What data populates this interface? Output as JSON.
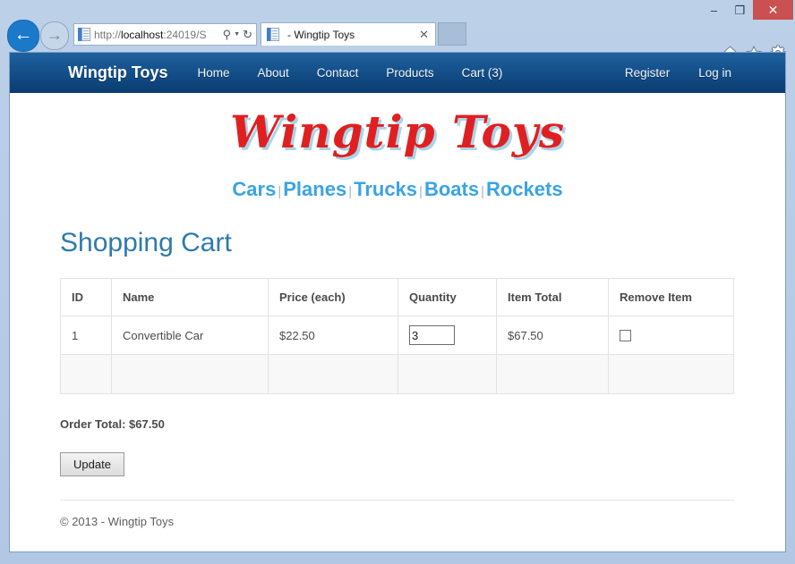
{
  "window": {
    "minimize_label": "–",
    "maximize_label": "❒",
    "close_label": "✕"
  },
  "browser": {
    "back_label": "←",
    "forward_label": "→",
    "url_prefix": "http://",
    "url_host": "localhost",
    "url_suffix": ":24019/S",
    "search_icon": "⚲",
    "caret_icon": "▼",
    "refresh_icon": "↻",
    "tab_title": "- Wingtip Toys",
    "tab_close_label": "✕",
    "new_tab_label": ""
  },
  "navbar": {
    "brand": "Wingtip Toys",
    "links": [
      {
        "label": "Home"
      },
      {
        "label": "About"
      },
      {
        "label": "Contact"
      },
      {
        "label": "Products"
      },
      {
        "label": "Cart (3)"
      }
    ],
    "right_links": [
      {
        "label": "Register"
      },
      {
        "label": "Log in"
      }
    ]
  },
  "logo": {
    "text": "Wingtip Toys",
    "color": "#e02020",
    "shadow_color": "#a8d4ea"
  },
  "categories": {
    "separator": "|",
    "items": [
      {
        "label": "Cars"
      },
      {
        "label": "Planes"
      },
      {
        "label": "Trucks"
      },
      {
        "label": "Boats"
      },
      {
        "label": "Rockets"
      }
    ],
    "color": "#3aa4e4"
  },
  "page": {
    "title": "Shopping Cart",
    "title_color": "#2e7bab"
  },
  "cart": {
    "columns": [
      "ID",
      "Name",
      "Price (each)",
      "Quantity",
      "Item Total",
      "Remove Item"
    ],
    "rows": [
      {
        "id": "1",
        "name": "Convertible Car",
        "price": "$22.50",
        "quantity": "3",
        "item_total": "$67.50",
        "remove_checked": false
      }
    ],
    "order_total_label": "Order Total: $67.50",
    "update_label": "Update"
  },
  "footer": {
    "text": "© 2013 - Wingtip Toys"
  }
}
